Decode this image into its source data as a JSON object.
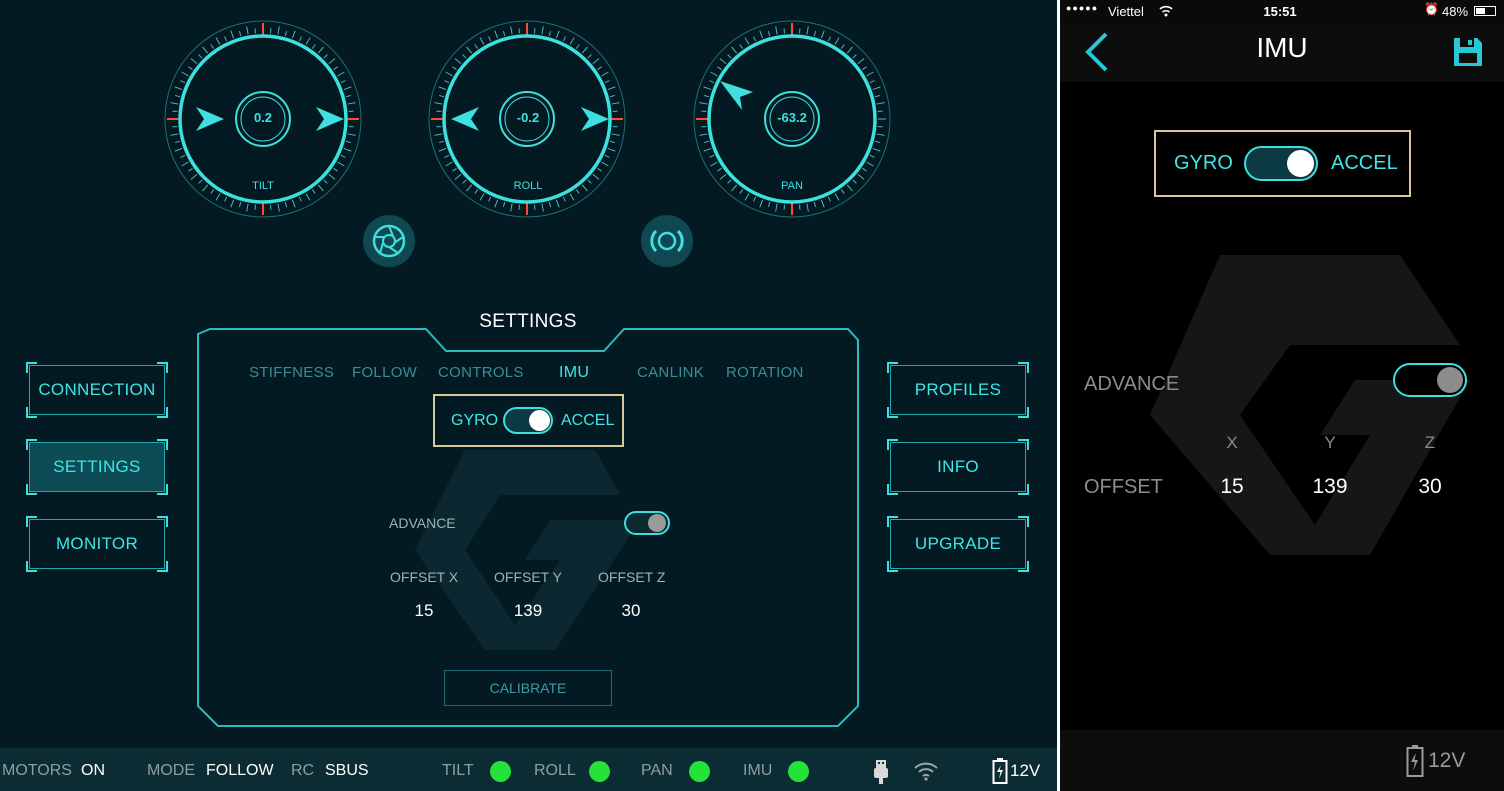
{
  "tablet": {
    "dials": [
      {
        "label": "TILT",
        "value": "0.2"
      },
      {
        "label": "ROLL",
        "value": "-0.2"
      },
      {
        "label": "PAN",
        "value": "-63.2"
      }
    ],
    "settings_title": "SETTINGS",
    "nav_left": [
      "CONNECTION",
      "SETTINGS",
      "MONITOR"
    ],
    "nav_right": [
      "PROFILES",
      "INFO",
      "UPGRADE"
    ],
    "active_nav": "SETTINGS",
    "tabs": [
      "STIFFNESS",
      "FOLLOW",
      "CONTROLS",
      "IMU",
      "CANLINK",
      "ROTATION"
    ],
    "active_tab": "IMU",
    "imu_toggle": {
      "left": "GYRO",
      "right": "ACCEL",
      "selected": "ACCEL"
    },
    "advance": {
      "label": "ADVANCE",
      "on": false
    },
    "offsets": [
      {
        "label": "OFFSET X",
        "value": "15"
      },
      {
        "label": "OFFSET Y",
        "value": "139"
      },
      {
        "label": "OFFSET Z",
        "value": "30"
      }
    ],
    "calibrate_label": "CALIBRATE",
    "status_bar": {
      "motors_key": "MOTORS",
      "motors_val": "ON",
      "mode_key": "MODE",
      "mode_val": "FOLLOW",
      "rc_key": "RC",
      "rc_val": "SBUS",
      "indicators": [
        "TILT",
        "ROLL",
        "PAN",
        "IMU"
      ],
      "battery": "12V"
    }
  },
  "phone": {
    "status": {
      "carrier": "Viettel",
      "time": "15:51",
      "battery": "48%"
    },
    "title": "IMU",
    "imu_toggle": {
      "left": "GYRO",
      "right": "ACCEL",
      "selected": "ACCEL"
    },
    "advance": {
      "label": "ADVANCE",
      "on": false
    },
    "axes": [
      "X",
      "Y",
      "Z"
    ],
    "offset_label": "OFFSET",
    "offset_values": [
      "15",
      "139",
      "30"
    ],
    "battery": "12V"
  },
  "colors": {
    "accent": "#3ee0df",
    "panel_bg": "#041a23",
    "status_green": "#24e23a",
    "highlight_border": "#d8c79a",
    "tick_red": "#ff4a3a"
  },
  "icons": [
    "aperture-icon",
    "rc-signal-icon",
    "usb-icon",
    "wifi-icon",
    "battery-icon",
    "back-chevron-icon",
    "save-icon"
  ]
}
